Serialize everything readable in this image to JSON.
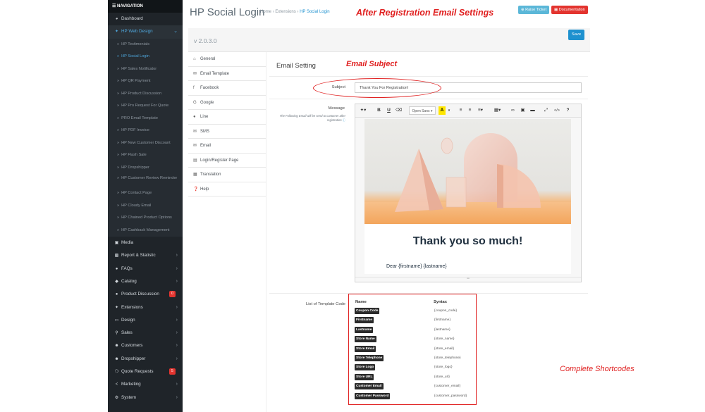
{
  "sidebar": {
    "header": "NAVIGATION",
    "dashboard": "Dashboard",
    "web_design": "HP Web Design",
    "sub_items": [
      {
        "label": "HP Testimonials"
      },
      {
        "label": "HP Social Login"
      },
      {
        "label": "HP Sales Notificator"
      },
      {
        "label": "HP QR Payment"
      },
      {
        "label": "HP Product Discussion"
      },
      {
        "label": "HP Pro Request For Quote"
      },
      {
        "label": "PRO Email Template"
      },
      {
        "label": "HP PDF Invoice"
      },
      {
        "label": "HP New Customer Discount"
      },
      {
        "label": "HP Flash Sale"
      },
      {
        "label": "HP Dropshipper"
      },
      {
        "label": "HP Customer Review Reminder"
      },
      {
        "label": "HP Contact Page"
      },
      {
        "label": "HP Cloudy Email"
      },
      {
        "label": "HP Chained Product Options"
      },
      {
        "label": "HP Cashback Management"
      }
    ],
    "main_items": [
      {
        "label": "Media"
      },
      {
        "label": "Report & Statistic"
      },
      {
        "label": "FAQs"
      },
      {
        "label": "Catalog"
      },
      {
        "label": "Product Discussion",
        "badge": "0"
      },
      {
        "label": "Extensions"
      },
      {
        "label": "Design"
      },
      {
        "label": "Sales"
      },
      {
        "label": "Customers"
      },
      {
        "label": "Dropshipper"
      },
      {
        "label": "Quote Requests",
        "badge": "5"
      },
      {
        "label": "Marketing"
      },
      {
        "label": "System"
      }
    ]
  },
  "header": {
    "title": "HP Social Login",
    "breadcrumb": [
      "Home",
      "Extensions",
      "HP Social Login"
    ],
    "annotation": "After Registration Email Settings",
    "raise_ticket": "Raise Ticket",
    "documentation": "Documentation"
  },
  "panel": {
    "version": "v 2.0.3.0",
    "save_label": "Save",
    "tabs": [
      {
        "label": "General"
      },
      {
        "label": "Email Template"
      },
      {
        "label": "Facebook"
      },
      {
        "label": "Google"
      },
      {
        "label": "Line"
      },
      {
        "label": "SMS"
      },
      {
        "label": "Email"
      },
      {
        "label": "Login/Register Page"
      },
      {
        "label": "Translation"
      },
      {
        "label": "Help"
      }
    ]
  },
  "content": {
    "section_title": "Email Setting",
    "annotation_subject": "Email Subject",
    "subject_label": "Subject",
    "subject_value": "Thank You For Registration!",
    "message_label": "Message",
    "message_help": "The Following Email will be send to customer after registration",
    "editor": {
      "font": "Open Sans",
      "thank_you": "Thank you so much!",
      "dear_line": "Dear {firstname} {lastname}"
    },
    "codes_label": "List of Template Code",
    "codes_head_name": "Name",
    "codes_head_syntax": "Syntax",
    "codes": [
      {
        "name": "Coupon Code",
        "syntax": "{coupon_code}"
      },
      {
        "name": "Firstname",
        "syntax": "{firstname}"
      },
      {
        "name": "Lastname",
        "syntax": "{lastname}"
      },
      {
        "name": "Store Name",
        "syntax": "{store_name}"
      },
      {
        "name": "Store Email",
        "syntax": "{store_email}"
      },
      {
        "name": "Store Telephone",
        "syntax": "{store_telephone}"
      },
      {
        "name": "Store Logo",
        "syntax": "{store_logo}"
      },
      {
        "name": "Store URL",
        "syntax": "{store_url}"
      },
      {
        "name": "Customer Email",
        "syntax": "{customer_email}"
      },
      {
        "name": "Customer Password",
        "syntax": "{customer_password}"
      }
    ],
    "annotation_codes": "Complete Shortcodes"
  },
  "colors": {
    "accent": "#1e91cf",
    "annotation": "#e02020",
    "sidebar_bg": "#1f2429"
  }
}
